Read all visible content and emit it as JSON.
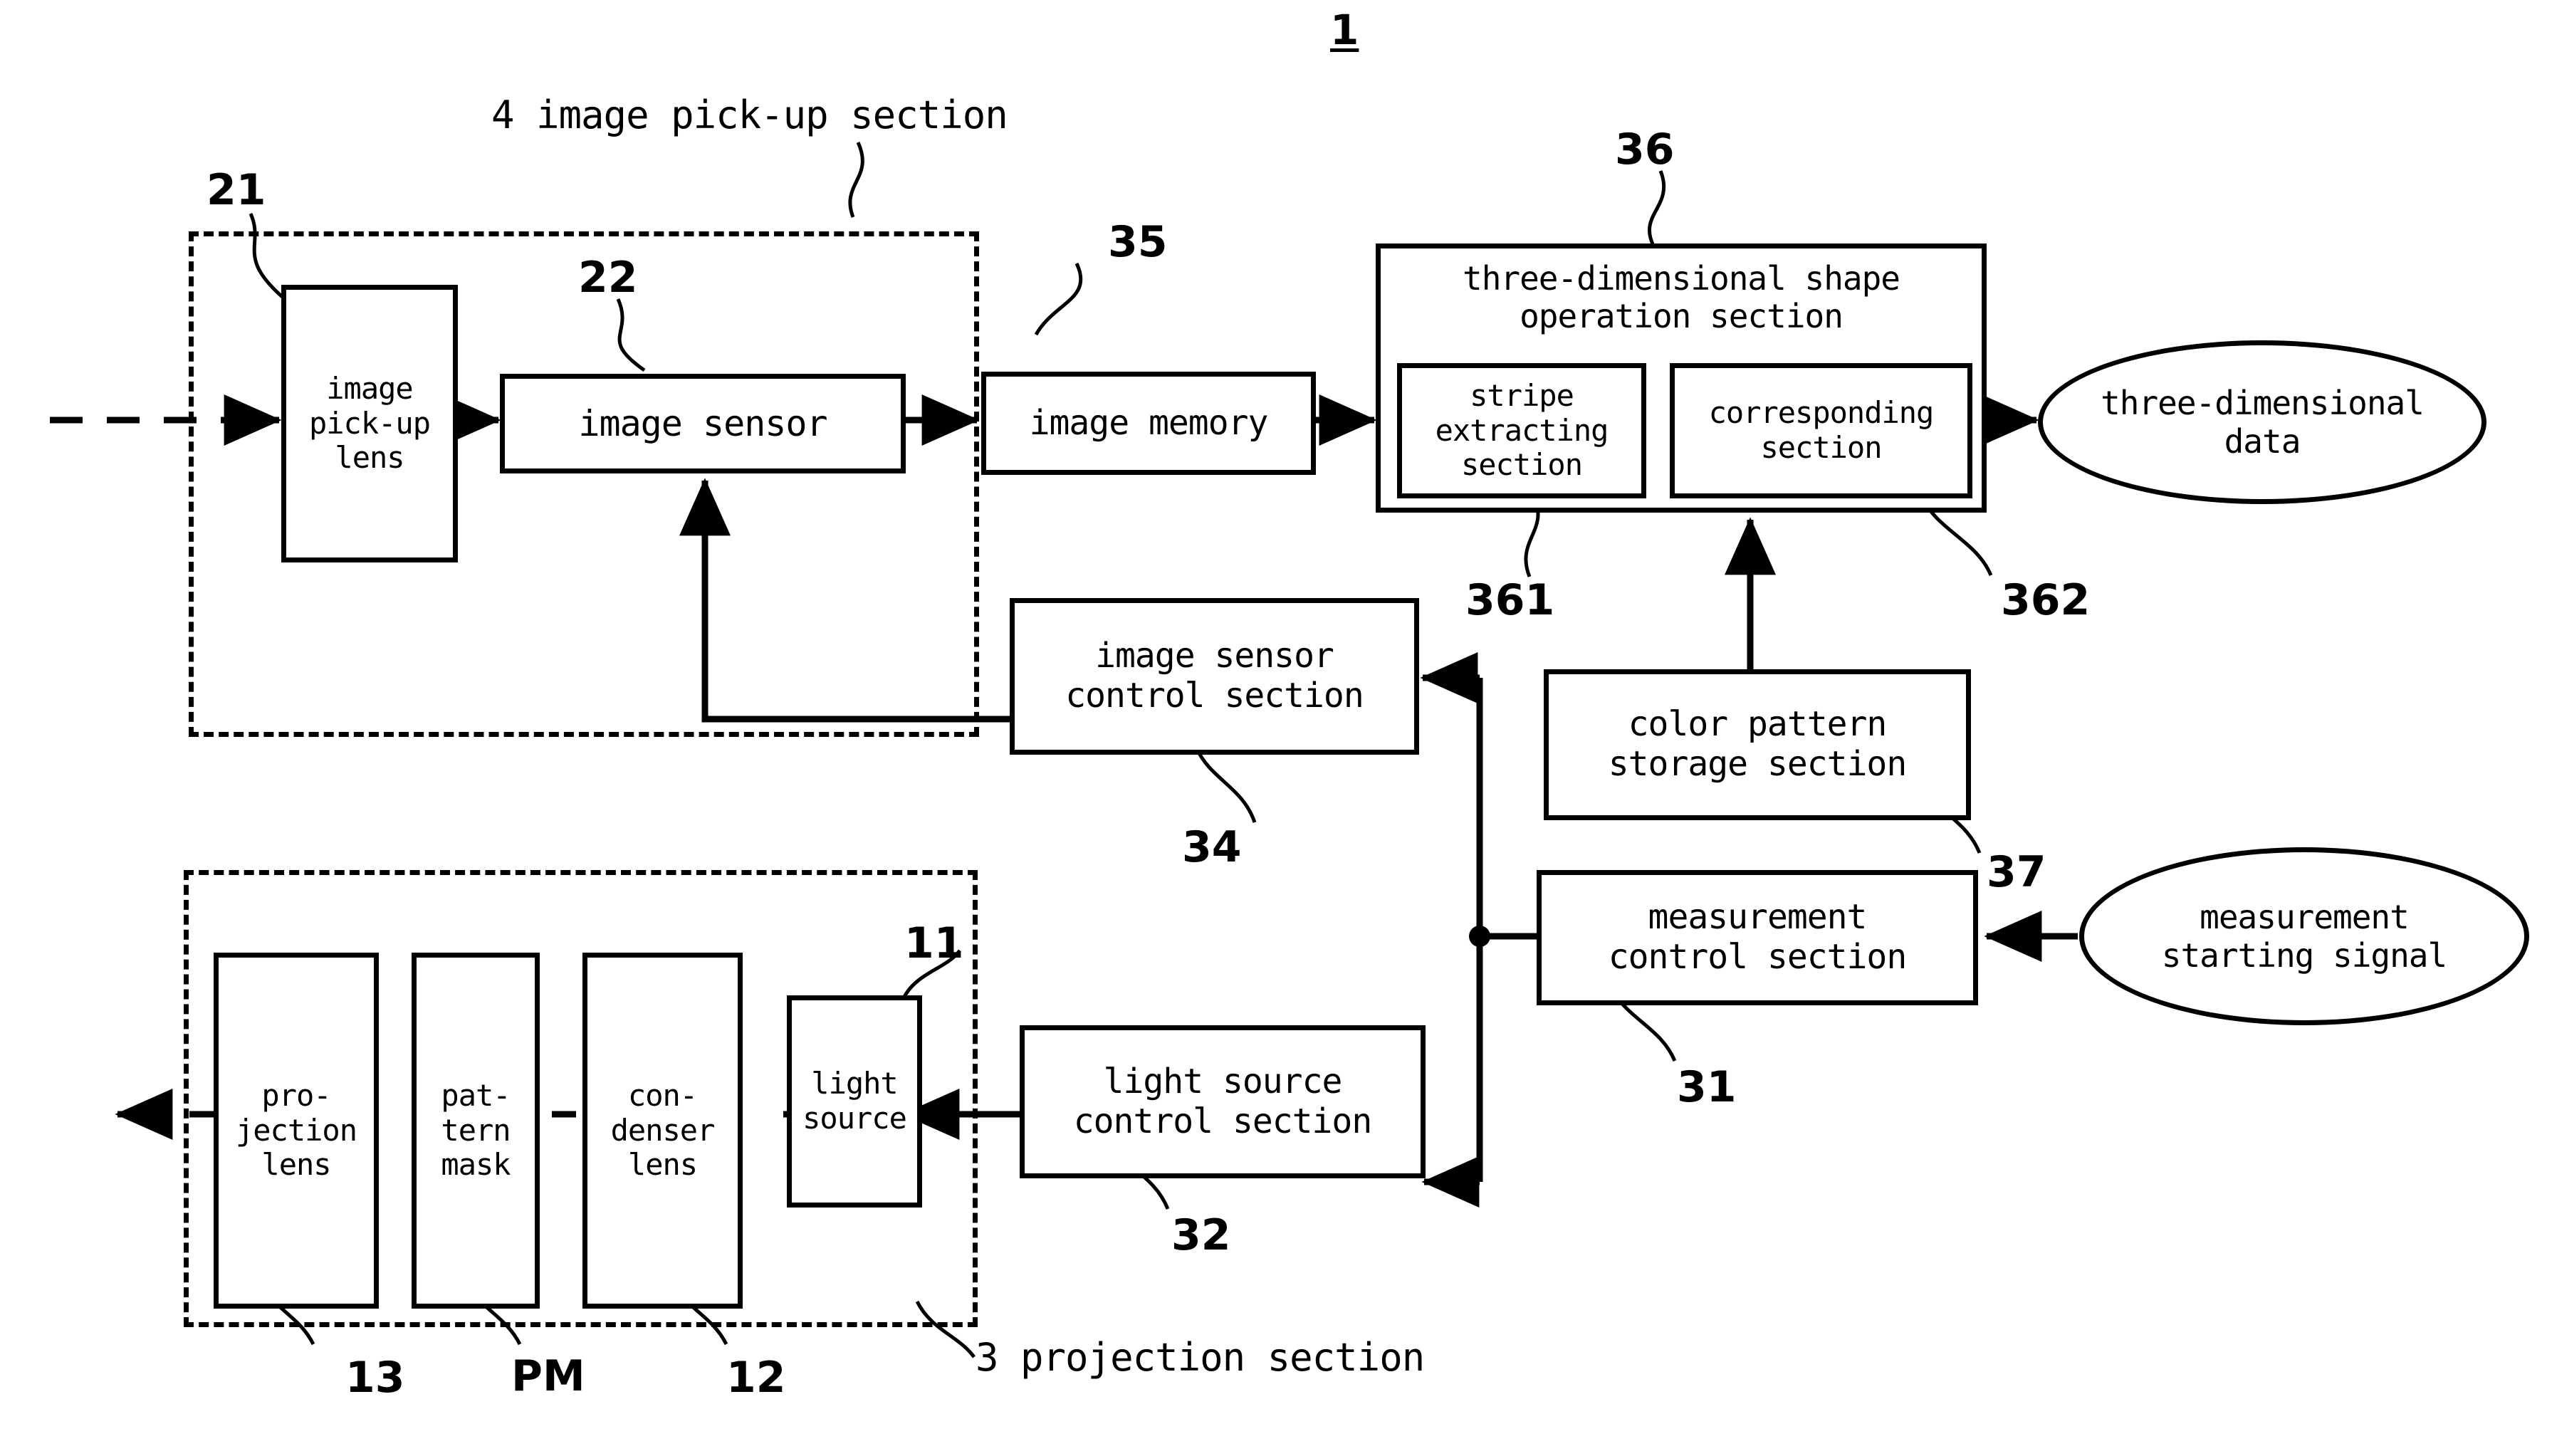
{
  "figure": {
    "number": "1",
    "captions": {
      "pickup_section": "4 image pick-up section",
      "projection_section": "3 projection section"
    }
  },
  "blocks": {
    "image_pickup_lens": "image\npick-up\nlens",
    "image_sensor": "image sensor",
    "image_memory": "image memory",
    "three_dim_shape_operation": "three-dimensional shape\noperation section",
    "stripe_extracting": "stripe\nextracting\nsection",
    "corresponding_section": "corresponding\nsection",
    "image_sensor_control": "image sensor\ncontrol section",
    "color_pattern_storage": "color pattern\nstorage section",
    "measurement_control": "measurement\ncontrol section",
    "light_source_control": "light source\ncontrol section",
    "light_source": "light\nsource",
    "projection_lens": "pro-\njection\nlens",
    "pattern_mask": "pat-\ntern\nmask",
    "condenser_lens": "con-\ndenser\nlens"
  },
  "terminals": {
    "three_dimensional_data": "three-dimensional\ndata",
    "measurement_starting_signal": "measurement\nstarting signal"
  },
  "reference_numerals": {
    "n21": "21",
    "n22": "22",
    "n35": "35",
    "n36": "36",
    "n361": "361",
    "n362": "362",
    "n34": "34",
    "n37": "37",
    "n31": "31",
    "n32": "32",
    "n11": "11",
    "n13": "13",
    "npm": "PM",
    "n12": "12"
  },
  "colors": {
    "ink": "#000000",
    "paper": "#ffffff"
  }
}
